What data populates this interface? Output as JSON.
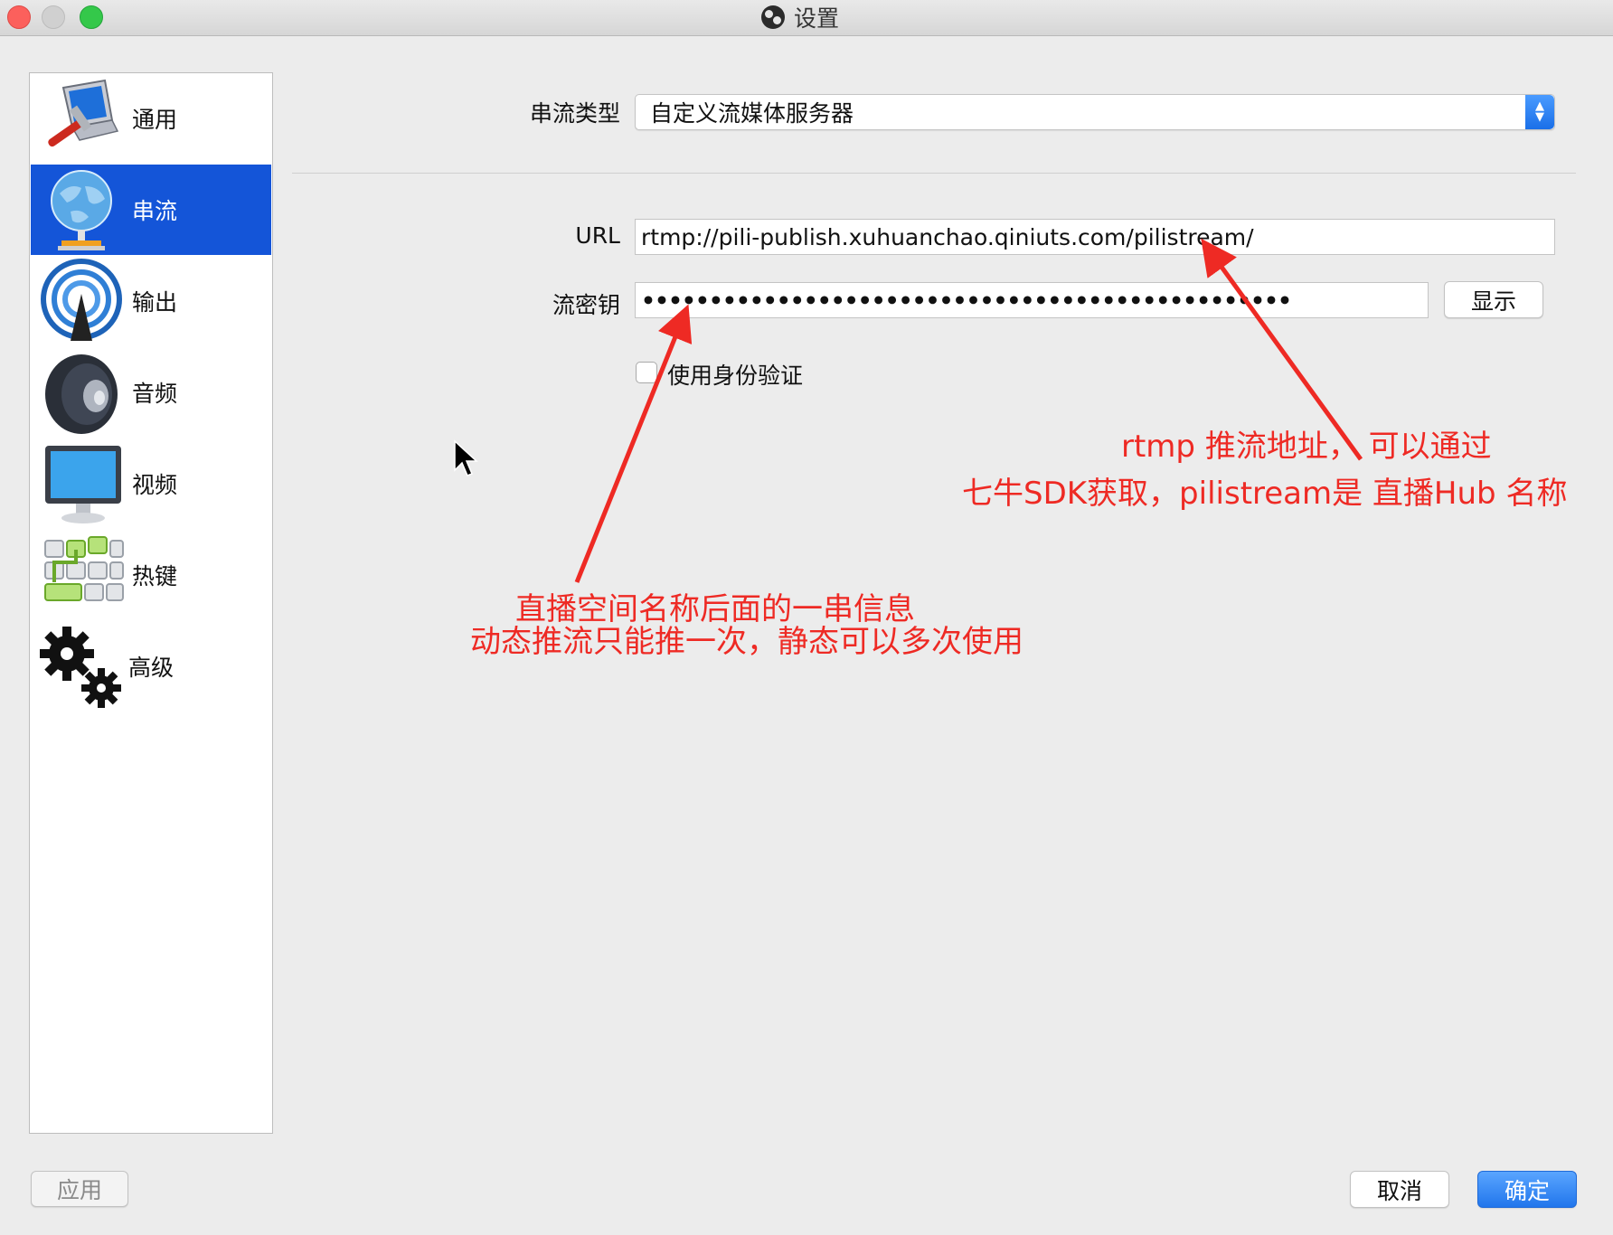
{
  "window": {
    "title": "设置"
  },
  "sidebar": {
    "items": [
      {
        "label": "通用",
        "icon": "monitor-wrench-icon"
      },
      {
        "label": "串流",
        "icon": "globe-network-icon",
        "active": true
      },
      {
        "label": "输出",
        "icon": "broadcast-antenna-icon"
      },
      {
        "label": "音频",
        "icon": "speaker-icon"
      },
      {
        "label": "视频",
        "icon": "display-monitor-icon"
      },
      {
        "label": "热键",
        "icon": "keyboard-keys-icon"
      },
      {
        "label": "高级",
        "icon": "gears-icon"
      }
    ]
  },
  "stream": {
    "type_label": "串流类型",
    "type_value": "自定义流媒体服务器",
    "url_label": "URL",
    "url_value": "rtmp://pili-publish.xuhuanchao.qiniuts.com/pilistream/",
    "key_label": "流密钥",
    "key_value": "••••••••••••••••••••••••••••••••••••••••••••••••",
    "show_button": "显示",
    "auth_label": "使用身份验证",
    "auth_checked": false
  },
  "annotations": {
    "url_note_line1": "rtmp 推流地址，  可以通过",
    "url_note_line2": "七牛SDK获取，pilistream是 直播Hub 名称",
    "key_note_line1": "直播空间名称后面的一串信息",
    "key_note_line2": "动态推流只能推一次，静态可以多次使用",
    "color": "#ee2a24"
  },
  "footer": {
    "apply": "应用",
    "cancel": "取消",
    "ok": "确定"
  },
  "colors": {
    "accent": "#1455d8",
    "primary_button": "#2176ec"
  }
}
